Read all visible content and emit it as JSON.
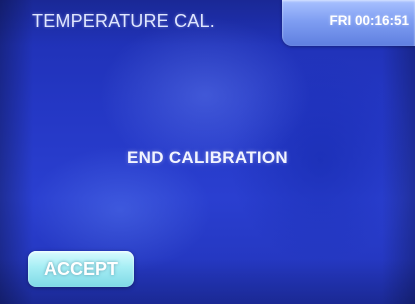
{
  "header": {
    "title": "TEMPERATURE CAL.",
    "clock": "FRI 00:16:51"
  },
  "main": {
    "message": "END CALIBRATION"
  },
  "footer": {
    "accept_label": "ACCEPT"
  },
  "colors": {
    "background": "#2437c4",
    "clock_box": "#7f9ef2",
    "accept_button": "#a6eef4",
    "text": "#ffffff"
  }
}
